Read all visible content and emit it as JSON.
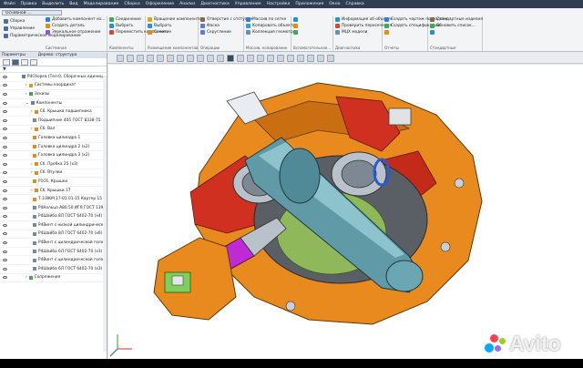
{
  "menu": [
    "Файл",
    "Правка",
    "Выделить",
    "Вид",
    "Моделирование",
    "Сборка",
    "Оформление",
    "Анализ",
    "Диагностика",
    "Управление",
    "Настройка",
    "Приложения",
    "Окно",
    "Справка"
  ],
  "document_tab": "Основной ...",
  "ribbon": {
    "left_buttons": [
      "Сборка",
      "Управление",
      "Параметрическое моделирование"
    ],
    "groups": [
      {
        "caption": "Системная",
        "buttons": [
          {
            "label": "Добавить компонент из...",
            "color": "#3a7bd5"
          },
          {
            "label": "Создать деталь",
            "color": "#d98e2b"
          },
          {
            "label": "Зеркальное отражение",
            "color": "#8a5cc4"
          }
        ]
      },
      {
        "caption": "Компоненты",
        "buttons": [
          {
            "label": "Соединение",
            "color": "#4aa35a"
          },
          {
            "label": "Выбрать",
            "color": "#2f8fc7"
          },
          {
            "label": "Переместить компонент",
            "color": "#c74a3a"
          }
        ]
      },
      {
        "caption": "Размещение компонентов",
        "buttons": [
          {
            "label": "Вращение компонентов",
            "color": "#d5a72f"
          },
          {
            "label": "Выбрать",
            "color": "#2f8fc7"
          },
          {
            "label": "Сечение",
            "color": "#d98e2b"
          }
        ]
      },
      {
        "caption": "Операции",
        "buttons": [
          {
            "label": "Отверстие с отступом",
            "color": "#7c6b5a"
          },
          {
            "label": "Фаска",
            "color": "#5c7bd5"
          },
          {
            "label": "Скругление",
            "color": "#5c7bd5"
          }
        ]
      },
      {
        "caption": "Массив, копирование",
        "buttons": [
          {
            "label": "Массив по сетке",
            "color": "#3a7bd5"
          },
          {
            "label": "Копировать объекты",
            "color": "#3a9bd5"
          },
          {
            "label": "Коллекция геометрии",
            "color": "#6a8fb8"
          }
        ]
      },
      {
        "caption": "Вспомогательная...",
        "buttons": [
          {
            "label": "",
            "color": "#2f8fc7"
          },
          {
            "label": "",
            "color": "#d98e2b"
          },
          {
            "label": "",
            "color": "#4aa35a"
          }
        ]
      },
      {
        "caption": "Диагностика",
        "buttons": [
          {
            "label": "Информация об объекте",
            "color": "#2f8fc7"
          },
          {
            "label": "Проверить пересечения",
            "color": "#c74a3a"
          },
          {
            "label": "МЦХ модели",
            "color": "#6a8fb8"
          }
        ]
      },
      {
        "caption": "Отчеты",
        "buttons": [
          {
            "label": "Создать чертеж по модели",
            "color": "#3a7bd5"
          },
          {
            "label": "Создать спецификацию",
            "color": "#4aa35a"
          },
          {
            "label": "",
            "color": "#d98e2b"
          }
        ]
      },
      {
        "caption": "Стандартные",
        "buttons": [
          {
            "label": "Стандартные изделия",
            "color": "#7c6b5a"
          },
          {
            "label": "Обновить список...",
            "color": "#4aa35a"
          },
          {
            "label": "",
            "color": "#2f8fc7"
          }
        ]
      }
    ]
  },
  "panel": {
    "title_left": "Параметры",
    "title_right": "Дерево: структура",
    "tree": [
      {
        "label": "Р4Сборка (Тел-0, Сборочных единиц...",
        "indent": 0,
        "sym": "",
        "color": "#6a7fa0",
        "sel": false
      },
      {
        "label": "Системы координат",
        "indent": 1,
        "sym": "›",
        "color": "#c9a227",
        "sel": false
      },
      {
        "label": "Эскизы",
        "indent": 1,
        "sym": "›",
        "color": "#4aa35a",
        "sel": false
      },
      {
        "label": "Компоненты",
        "indent": 1,
        "sym": "⌄",
        "color": "#6a7fa0",
        "sel": false
      },
      {
        "label": "Сб. Крышка подшипника",
        "indent": 2,
        "sym": "›",
        "color": "#d98e2b",
        "sel": false
      },
      {
        "label": "Подшипник 405 ГОСТ 8338-75",
        "indent": 2,
        "sym": "",
        "color": "#7a8899",
        "sel": false
      },
      {
        "label": "Сб. Вал",
        "indent": 2,
        "sym": "›",
        "color": "#d98e2b",
        "sel": false
      },
      {
        "label": "Головка цилиндра 1",
        "indent": 2,
        "sym": "",
        "color": "#d98e2b",
        "sel": false
      },
      {
        "label": "Головка цилиндра 2 (x2)",
        "indent": 2,
        "sym": "",
        "color": "#d98e2b",
        "sel": false
      },
      {
        "label": "Головка цилиндра 3 (x2)",
        "indent": 2,
        "sym": "",
        "color": "#d98e2b",
        "sel": false
      },
      {
        "label": "Сб. Пробка 25 (x3)",
        "indent": 2,
        "sym": "›",
        "color": "#d98e2b",
        "sel": false
      },
      {
        "label": "Сб. Втулки",
        "indent": 2,
        "sym": "›",
        "color": "#d98e2b",
        "sel": false
      },
      {
        "label": "Р1Сб. Крышки",
        "indent": 2,
        "sym": "",
        "color": "#d98e2b",
        "sel": false
      },
      {
        "label": "Сб. Крышки 17",
        "indent": 2,
        "sym": "›",
        "color": "#d98e2b",
        "sel": false
      },
      {
        "label": "Т.3.ВКМ.17-01.01-15 Картер 15",
        "indent": 2,
        "sym": "",
        "color": "#d98e2b",
        "sel": false
      },
      {
        "label": "Р4Кольцо А80.50 ИГЯ ГОСТ 13941",
        "indent": 2,
        "sym": "",
        "color": "#7a8899",
        "sel": false
      },
      {
        "label": "Р4Шайба 8Л ГОСТ 6402-70 (x4)",
        "indent": 2,
        "sym": "",
        "color": "#7a8899",
        "sel": false
      },
      {
        "label": "Р4Винт с низкой цилиндрической...",
        "indent": 2,
        "sym": "",
        "color": "#7a8899",
        "sel": false
      },
      {
        "label": "Р4Шайба 8Л ГОСТ 6402-70 (x6)",
        "indent": 2,
        "sym": "",
        "color": "#7a8899",
        "sel": false
      },
      {
        "label": "Р4Винт с цилиндрической голо...",
        "indent": 2,
        "sym": "",
        "color": "#7a8899",
        "sel": false
      },
      {
        "label": "Р4Шайба 6Л ГОСТ 6402-70 (x3)",
        "indent": 2,
        "sym": "",
        "color": "#7a8899",
        "sel": false
      },
      {
        "label": "Р4Винт с цилиндрической голо...",
        "indent": 2,
        "sym": "",
        "color": "#7a8899",
        "sel": false
      },
      {
        "label": "Р4Шайба 6Л ГОСТ 6402-70 (x3)",
        "indent": 2,
        "sym": "",
        "color": "#7a8899",
        "sel": false
      },
      {
        "label": "Сопряжения",
        "indent": 1,
        "sym": "›",
        "color": "#4aa35a",
        "sel": false
      }
    ]
  },
  "colors": {
    "part_orange": "#e88a1e",
    "part_red": "#d0301f",
    "shaft": "#5f9aa6",
    "magenta": "#c02ad6",
    "green": "#7fd05a",
    "menu_bg": "#2f3e52"
  },
  "watermark": "Avito"
}
